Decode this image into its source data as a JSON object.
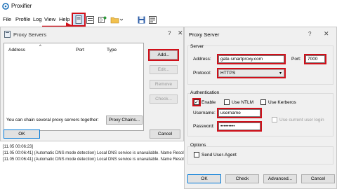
{
  "app": {
    "title": "Proxifier"
  },
  "menu": [
    "File",
    "Profile",
    "Log",
    "View",
    "Help"
  ],
  "toolbar_icons": [
    "proxy-servers-icon",
    "proxification-rules-icon",
    "name-resolution-icon",
    "open-folder-icon",
    "save-icon",
    "options-icon"
  ],
  "log": [
    "[11.05 00:06:23]",
    "[11.05 00:06:41] (Automatic DNS mode detection) Local DNS service is unavailable. Name Resol",
    "[11.05 00:06:41] (Automatic DNS mode detection) Local DNS service is unavailable. Name Resol"
  ],
  "proxy_servers": {
    "title": "Proxy Servers",
    "columns": [
      "Address",
      "Port",
      "Type"
    ],
    "add": "Add...",
    "edit": "Edit...",
    "remove": "Remove",
    "check": "Check...",
    "chain_text": "You can chain several proxy servers together:",
    "chains": "Proxy Chains...",
    "ok": "OK",
    "cancel": "Cancel"
  },
  "proxy_server": {
    "title": "Proxy Server",
    "help": "?",
    "server_group": "Server",
    "address_label": "Address:",
    "address_value": "gate.smartproxy.com",
    "port_label": "Port:",
    "port_value": "7000",
    "protocol_label": "Protocol:",
    "protocol_value": "HTTPS",
    "auth_group": "Authentication",
    "enable": "Enable",
    "ntlm": "Use NTLM",
    "kerberos": "Use Kerberos",
    "username_label": "Username:",
    "username_value": "username",
    "current_user": "Use current user login",
    "password_label": "Password:",
    "password_value": "•••••••••",
    "options_group": "Options",
    "send_user_agent": "Send User-Agent",
    "ok": "OK",
    "check": "Check",
    "advanced": "Advanced...",
    "cancel": "Cancel"
  },
  "colors": {
    "highlight": "#d0101a",
    "dialog_bg": "#f0f0f0"
  }
}
